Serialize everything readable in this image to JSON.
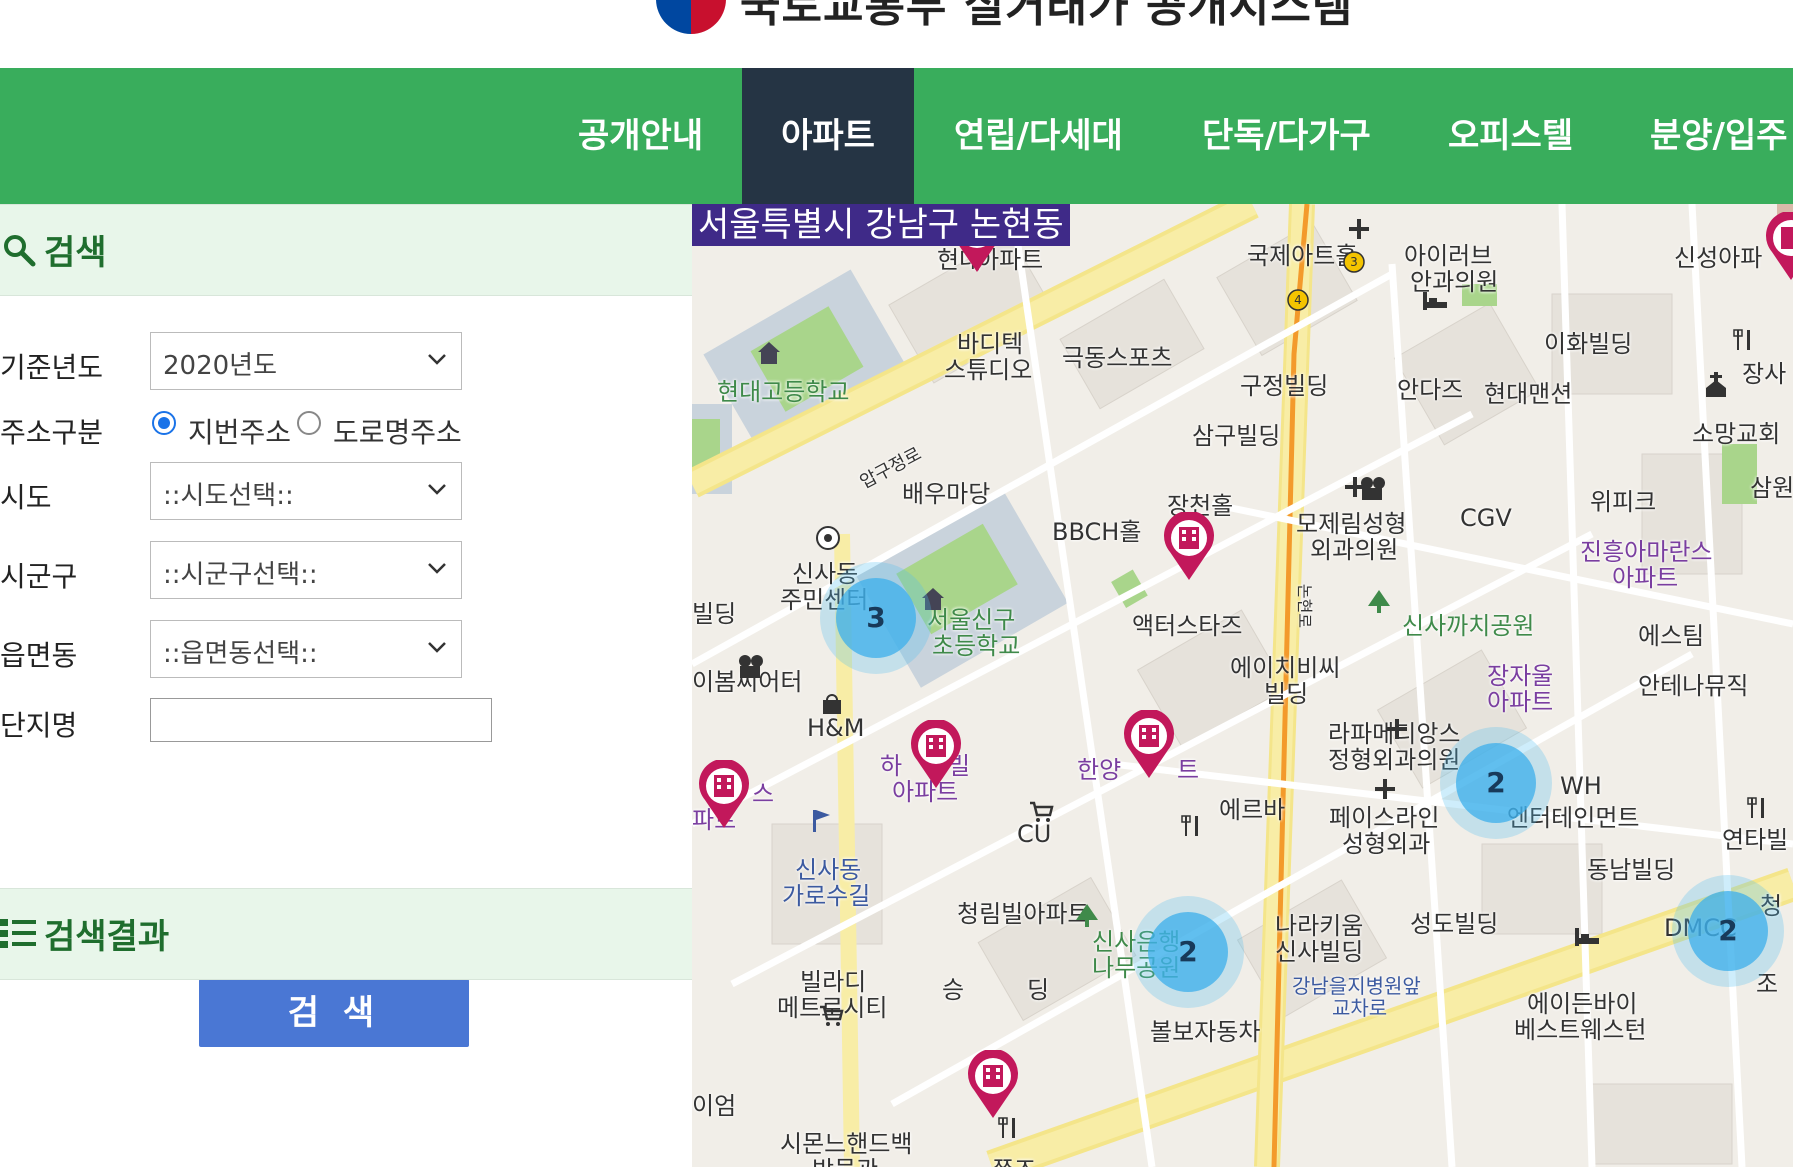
{
  "header": {
    "logo_icon": "government-taegeuk-logo-icon",
    "site_title": "국토교통부 실거래가 공개시스템"
  },
  "nav": {
    "items": [
      {
        "label": "공개안내"
      },
      {
        "label": "아파트"
      },
      {
        "label": "연립/다세대"
      },
      {
        "label": "단독/다가구"
      },
      {
        "label": "오피스텔"
      },
      {
        "label": "분양/입주"
      }
    ],
    "active": "아파트",
    "bg_color": "#39ad5c",
    "active_color": "#253444"
  },
  "search": {
    "heading": "검색",
    "year_label": "기준년도",
    "year_value": "2020년도",
    "address_type_label": "주소구분",
    "address_options": [
      {
        "label": "지번주소",
        "checked": true
      },
      {
        "label": "도로명주소",
        "checked": false
      }
    ],
    "sido_label": "시도",
    "sido_value": "::시도선택::",
    "sigungu_label": "시군구",
    "sigungu_value": "::시군구선택::",
    "dong_label": "읍면동",
    "dong_value": "::읍면동선택::",
    "complex_label": "단지명",
    "complex_value": "",
    "button_label": "검 색",
    "button_color": "#4a77d4"
  },
  "results": {
    "heading": "검색결과"
  },
  "map": {
    "address": "서울특별시 강남구 논현동",
    "clusters": [
      "3",
      "2",
      "2",
      "2"
    ],
    "labels": [
      "국제아트홀",
      "아이러브",
      "안과의원",
      "신성아파",
      "바디텍",
      "스튜디오",
      "극동스포츠",
      "구정빌딩",
      "이화빌딩",
      "현대고등학교",
      "안다즈",
      "현대맨션",
      "장사",
      "소망교회",
      "삼구빌딩",
      "압구정로",
      "배우마당",
      "장천홀",
      "모제림성형",
      "외과의원",
      "CGV",
      "위피크",
      "삼원",
      "BBCH홀",
      "진흥아마란스",
      "아파트",
      "신사동",
      "주민센터",
      "서울신구",
      "초등학교",
      "액터스타즈",
      "신사까치공원",
      "에스팀",
      "빌딩",
      "에이치비씨",
      "빌딩",
      "장자울",
      "아파트",
      "안테나뮤직",
      "이봄씨어터",
      "H&M",
      "라파메디앙스",
      "정형외과의원",
      "하",
      "빌",
      "아파트",
      "한양",
      "트",
      "스",
      "파트",
      "에르바",
      "페이스라인",
      "성형외과",
      "WH",
      "엔터테인먼트",
      "CU",
      "연타빌",
      "신사동",
      "가로수길",
      "동남빌딩",
      "청림빌아파트",
      "나라키움",
      "신사빌딩",
      "성도빌딩",
      "DMCC",
      "청",
      "신사은행",
      "나무공원",
      "강남을지병원앞",
      "교차로",
      "빌라디",
      "메트로시티",
      "에이든바이",
      "베스트웨스턴",
      "조",
      "승",
      "딩",
      "볼보자동차",
      "시몬느핸드백",
      "박물관",
      "쭈즈",
      "이엄",
      "현대",
      "아파트",
      "논현로"
    ]
  }
}
